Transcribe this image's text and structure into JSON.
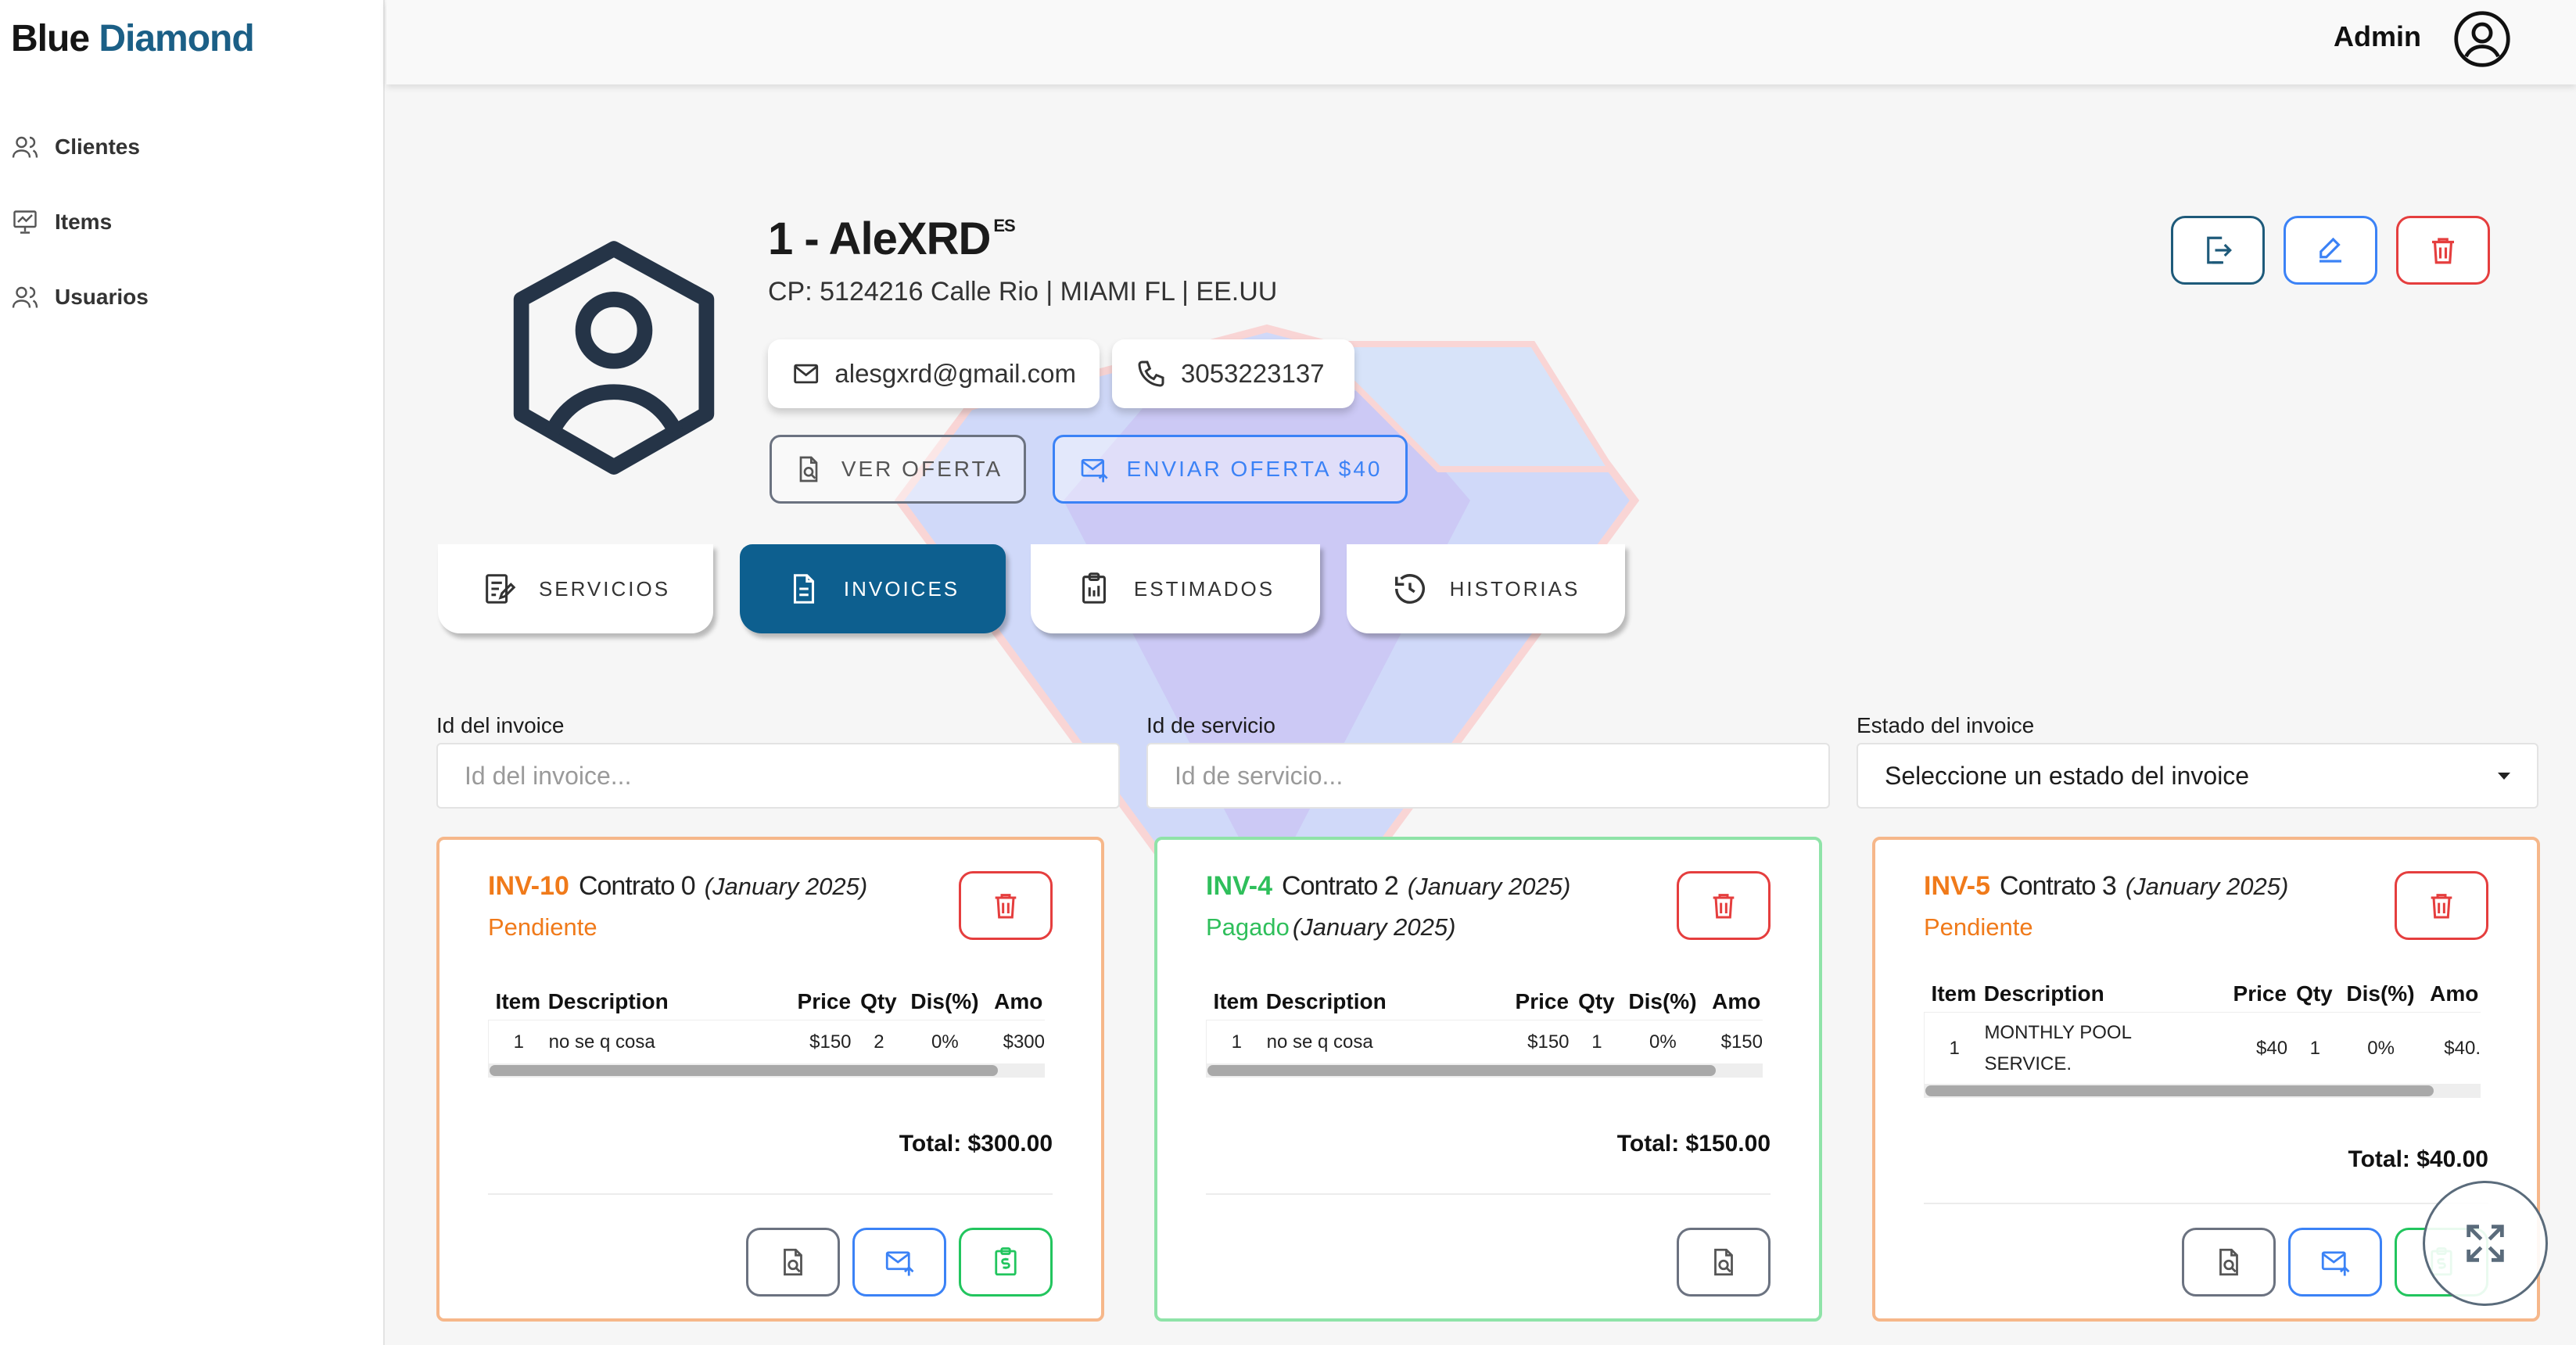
{
  "brand": {
    "part1": "Blue",
    "part2": "Diamond"
  },
  "sidebar": {
    "items": [
      {
        "label": "Clientes",
        "icon": "users-icon"
      },
      {
        "label": "Items",
        "icon": "chart-board-icon"
      },
      {
        "label": "Usuarios",
        "icon": "users-icon"
      }
    ]
  },
  "header": {
    "user_name": "Admin"
  },
  "client": {
    "title": "1 - AleXRD",
    "lang": "ES",
    "address": "CP: 5124216  Calle Rio | MIAMI FL | EE.UU",
    "email": "alesgxrd@gmail.com",
    "phone": "3053223137",
    "ver_oferta": "VER OFERTA",
    "enviar_oferta": "ENVIAR OFERTA $40"
  },
  "tabs": [
    {
      "label": "SERVICIOS",
      "active": false
    },
    {
      "label": "INVOICES",
      "active": true
    },
    {
      "label": "ESTIMADOS",
      "active": false
    },
    {
      "label": "HISTORIAS",
      "active": false
    }
  ],
  "filters": {
    "invoice_id": {
      "label": "Id del invoice",
      "placeholder": "Id del invoice..."
    },
    "service_id": {
      "label": "Id de servicio",
      "placeholder": "Id de servicio..."
    },
    "status": {
      "label": "Estado del invoice",
      "value": "Seleccione un estado del invoice"
    }
  },
  "table_headers": {
    "item": "Item",
    "description": "Description",
    "price": "Price",
    "qty": "Qty",
    "discount": "Dis(%)",
    "amount": "Amo"
  },
  "invoices": [
    {
      "id": "INV-10",
      "contract": "Contrato 0",
      "period": "(January 2025)",
      "status": "Pendiente",
      "status_period": "",
      "status_color": "#f07a1a",
      "rows": [
        {
          "item": "1",
          "description": "no se q cosa",
          "price": "$150",
          "qty": "2",
          "discount": "0%",
          "amount": "$300"
        }
      ],
      "total": "Total: $300.00"
    },
    {
      "id": "INV-4",
      "contract": "Contrato 2",
      "period": "(January 2025)",
      "status": "Pagado",
      "status_period": "(January 2025)",
      "status_color": "#2fbf5b",
      "rows": [
        {
          "item": "1",
          "description": "no se q cosa",
          "price": "$150",
          "qty": "1",
          "discount": "0%",
          "amount": "$150"
        }
      ],
      "total": "Total: $150.00"
    },
    {
      "id": "INV-5",
      "contract": "Contrato 3",
      "period": "(January 2025)",
      "status": "Pendiente",
      "status_period": "",
      "status_color": "#f07a1a",
      "rows": [
        {
          "item": "1",
          "description": "MONTHLY POOL SERVICE.",
          "price": "$40",
          "qty": "1",
          "discount": "0%",
          "amount": "$40."
        }
      ],
      "total": "Total: $40.00"
    }
  ],
  "colors": {
    "brand_blue": "#1b5f86",
    "active_tab": "#0d5f8f",
    "danger": "#e53e3e",
    "primary": "#3b82f6",
    "success": "#22c55e",
    "pending": "#f07a1a"
  }
}
